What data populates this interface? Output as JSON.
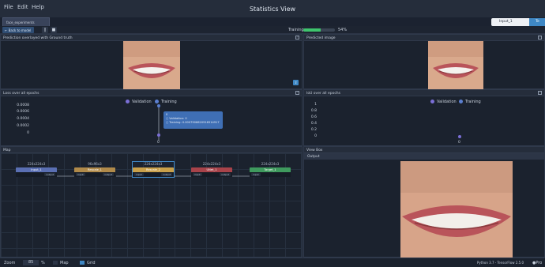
{
  "menu": {
    "file": "File",
    "edit": "Edit",
    "help": "Help"
  },
  "window": {
    "title": "Statistics View"
  },
  "tabs": {
    "file_tab": "face_experiments",
    "right_tab_1": "Input_1",
    "right_tab_2": "Te"
  },
  "toolbar": {
    "back_label": "Back to model",
    "training_label": "Training",
    "progress_percent": 54,
    "progress_text": "54%"
  },
  "panels": {
    "prediction_overlay": {
      "title": "Prediction overlayed with Ground truth"
    },
    "predicted_image": {
      "title": "Predicted image"
    },
    "loss": {
      "title": "Loss over all epochs",
      "legend": [
        "Validation",
        "Training"
      ],
      "yticks": [
        "0.0008",
        "0.0006",
        "0.0004",
        "0.0002",
        "0"
      ],
      "xtick": "0",
      "tooltip": {
        "header": "0",
        "validation": "Validation: 0",
        "training": "Training: 0.0007906620916514917"
      }
    },
    "iou": {
      "title": "IoU over all epochs",
      "legend": [
        "Validation",
        "Training"
      ],
      "yticks": [
        "1",
        "0.8",
        "0.6",
        "0.4",
        "0.2",
        "0"
      ],
      "xtick": "0"
    },
    "map": {
      "title": "Map"
    },
    "viewbox": {
      "title": "View Box",
      "subtitle": "Output"
    }
  },
  "nodes": [
    {
      "dims": "224x224x3",
      "name": "Input_1",
      "color": "#5a6fb3",
      "in_label": "",
      "out_label": "output"
    },
    {
      "dims": "96x96x3",
      "name": "Rescale_1",
      "color": "#b08a4a",
      "in_label": "input",
      "out_label": "output"
    },
    {
      "dims": "224x224x3",
      "name": "Rescale_2",
      "color": "#c9a04a",
      "in_label": "input",
      "out_label": "output"
    },
    {
      "dims": "224x224x3",
      "name": "UNet_1",
      "color": "#a8434a",
      "in_label": "input",
      "out_label": "output"
    },
    {
      "dims": "224x224x3",
      "name": "Target_1",
      "color": "#3f9a5e",
      "in_label": "input",
      "out_label": ""
    }
  ],
  "statusbar": {
    "zoom_label": "Zoom",
    "zoom_value": "85",
    "zoom_unit": "%",
    "map_label": "Map",
    "grid_label": "Grid",
    "runtime": "Python 3.7 - TensorFlow 2.5.0",
    "extra": "Pro"
  },
  "colors": {
    "accent": "#3f88c5",
    "validation": "#7b6fd6",
    "training": "#5b7fd0",
    "progress": "#3ec46d"
  }
}
